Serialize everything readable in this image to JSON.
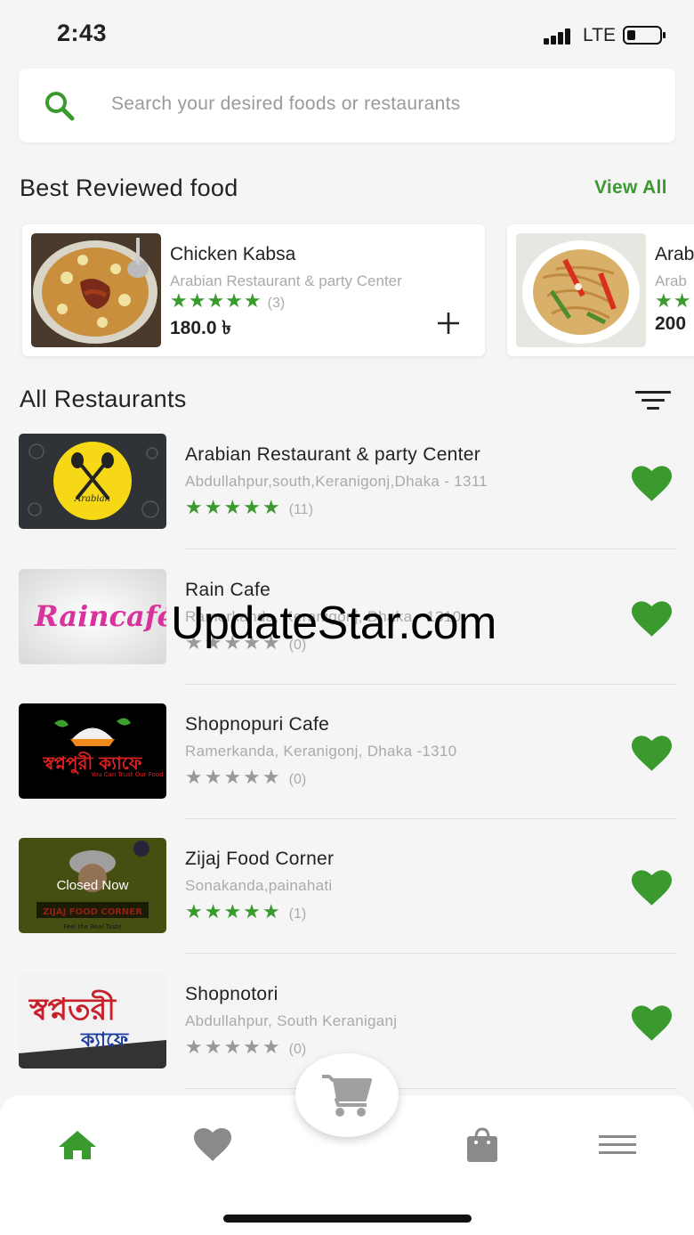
{
  "status_bar": {
    "time": "2:43",
    "network": "LTE"
  },
  "search": {
    "placeholder": "Search your desired foods or restaurants"
  },
  "best_reviewed": {
    "title": "Best Reviewed food",
    "view_all": "View All",
    "items": [
      {
        "name": "Chicken Kabsa",
        "restaurant": "Arabian Restaurant & party Center",
        "stars": "★★★★★",
        "reviews": "(3)",
        "price": "180.0 ৳"
      },
      {
        "name": "Arab",
        "restaurant": "Arab",
        "stars": "★★",
        "reviews": "",
        "price": "200"
      }
    ]
  },
  "all_restaurants": {
    "title": "All Restaurants",
    "items": [
      {
        "name": "Arabian Restaurant & party Center",
        "address": "Abdullahpur,south,Keranigonj,Dhaka - 1311",
        "stars": "★★★★★",
        "rating": 5,
        "reviews": "(11)"
      },
      {
        "name": "Rain Cafe",
        "address": "Ramerkanda, Keranigonj, Dhaka - 1310",
        "stars": "★★★★★",
        "rating": 0,
        "reviews": "(0)"
      },
      {
        "name": "Shopnopuri Cafe",
        "address": "Ramerkanda, Keranigonj, Dhaka -1310",
        "stars": "★★★★★",
        "rating": 0,
        "reviews": "(0)"
      },
      {
        "name": "Zijaj Food Corner",
        "address": "Sonakanda,painahati",
        "stars": "★★★★★",
        "rating": 5,
        "reviews": "(1)",
        "status": "Closed Now"
      },
      {
        "name": "Shopnotori",
        "address": "Abdullahpur, South Keraniganj",
        "stars": "★★★★★",
        "rating": 0,
        "reviews": "(0)"
      }
    ]
  },
  "logos": {
    "rain": "Raincafé",
    "shopnopuri": "স্বপ্নপুরী ক্যাফে",
    "shopnopuri_tagline": "You Can Trust Our Food",
    "zijaj": "ZIJAJ FOOD CORNER",
    "zijaj_tagline": "Feel the Real Taste",
    "shopnotori_1": "স্বপ্নতরী",
    "shopnotori_2": "ক্যাফে",
    "arabian": "Arabian"
  },
  "watermark": "UpdateStar.com",
  "bottom_nav": [
    "home-icon",
    "heart-icon",
    "cart-icon",
    "bag-icon",
    "menu-icon"
  ],
  "colors": {
    "accent": "#3a9a2e",
    "gray_star": "#999999",
    "background": "#f5f5f5"
  }
}
